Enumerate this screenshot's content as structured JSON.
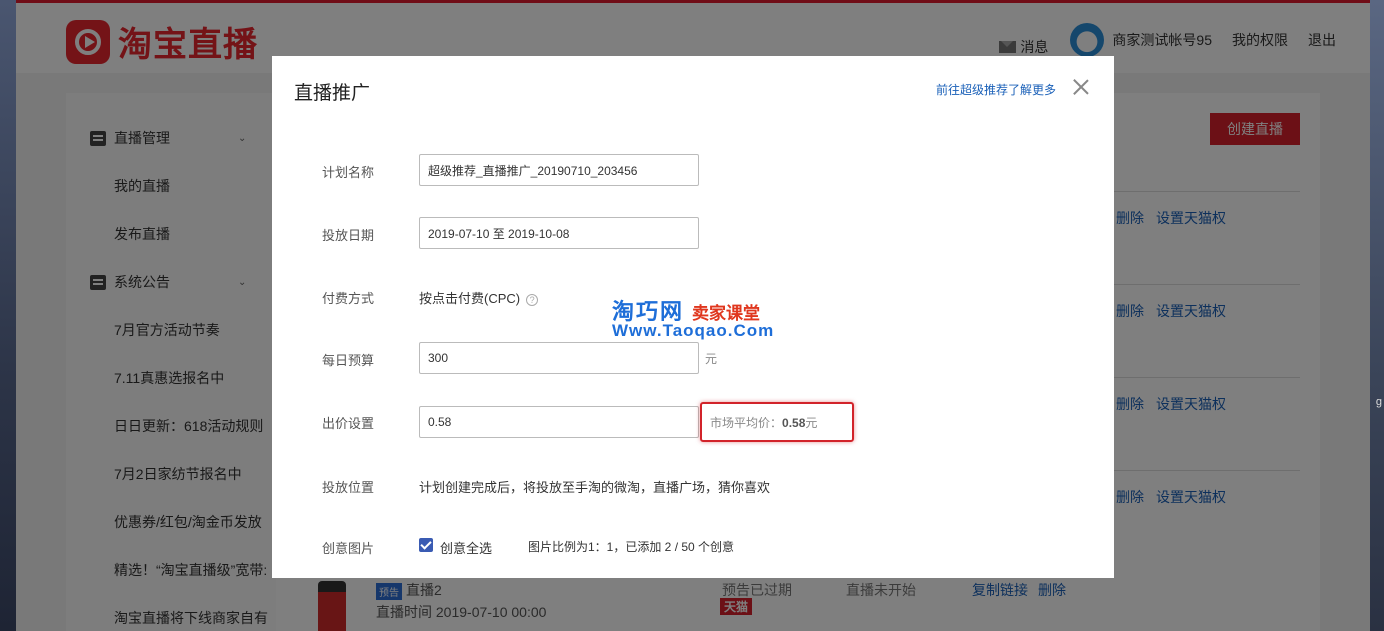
{
  "header": {
    "logo_text": "淘宝直播",
    "messages": "消息",
    "account": "商家测试帐号95",
    "permissions": "我的权限",
    "logout": "退出"
  },
  "sidebar": {
    "group1": "直播管理",
    "items1": [
      "我的直播",
      "发布直播"
    ],
    "group2": "系统公告",
    "items2": [
      "7月官方活动节奏",
      "7.11真惠选报名中",
      "日日更新：618活动规则",
      "7月2日家纺节报名中",
      "优惠券/红包/淘金币发放",
      "精选！“淘宝直播级”宽带:",
      "淘宝直播将下线商家自有"
    ]
  },
  "main": {
    "create_button": "创建直播",
    "row_actions": {
      "delete": "删除",
      "set_tmall": "设置天猫权"
    },
    "last_row": {
      "tag": "预告",
      "title": "直播2",
      "time": "直播时间 2019-07-10 00:00",
      "preview_status": "预告已过期",
      "tmall": "天猫",
      "live_status": "直播未开始",
      "copy_link": "复制链接",
      "delete": "删除"
    }
  },
  "modal": {
    "title": "直播推广",
    "link": "前往超级推荐了解更多",
    "fields": {
      "plan_name_label": "计划名称",
      "plan_name_value": "超级推荐_直播推广_20190710_203456",
      "date_label": "投放日期",
      "date_value": "2019-07-10 至 2019-10-08",
      "pay_label": "付费方式",
      "pay_value": "按点击付费(CPC)",
      "budget_label": "每日预算",
      "budget_value": "300",
      "budget_unit": "元",
      "bid_label": "出价设置",
      "bid_value": "0.58",
      "avg_price_prefix": "市场平均价：",
      "avg_price_value": "0.58",
      "avg_price_unit": "元",
      "position_label": "投放位置",
      "position_value": "计划创建完成后，将投放至手淘的微淘，直播广场，猜你喜欢",
      "creative_label": "创意图片",
      "select_all": "创意全选",
      "ratio_text": "图片比例为1：1，已添加 2 / 50 个创意"
    }
  },
  "watermark": {
    "cn": "淘巧网",
    "cn_sub": "卖家课堂",
    "url": "Www.Taoqao.Com"
  },
  "desktop_fragment": "g"
}
